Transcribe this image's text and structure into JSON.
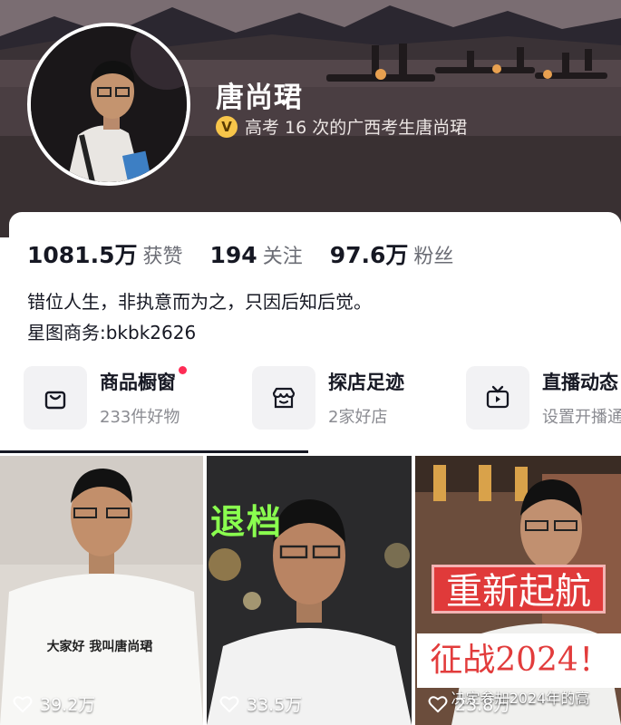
{
  "profile": {
    "nickname": "唐尚珺",
    "verify_text": "高考 16 次的广西考生唐尚珺",
    "verify_badge": "V"
  },
  "stats": [
    {
      "value": "1081.5万",
      "label": "获赞"
    },
    {
      "value": "194",
      "label": "关注"
    },
    {
      "value": "97.6万",
      "label": "粉丝"
    }
  ],
  "bio": {
    "line1": "错位人生，非执意而为之，只因后知后觉。",
    "line2": "星图商务:bkbk2626"
  },
  "features": [
    {
      "title": "商品橱窗",
      "subtitle": "233件好物",
      "icon": "shopping-bag-icon"
    },
    {
      "title": "探店足迹",
      "subtitle": "2家好店",
      "icon": "storefront-icon"
    },
    {
      "title": "直播动态",
      "subtitle": "设置开播通",
      "icon": "tv-icon"
    }
  ],
  "videos": [
    {
      "likes": "39.2万",
      "caption": "大家好 我叫唐尚珺"
    },
    {
      "likes": "33.5万",
      "caption": "退档"
    },
    {
      "likes": "23.8万",
      "caption_top": "重新起航",
      "caption_mid": "征战2024！",
      "caption_sub": "决定参加2024年的高"
    }
  ],
  "colors": {
    "accent": "#fe2c55",
    "verify_badge": "#f7c54a",
    "text_primary": "#161823",
    "text_secondary": "#6b6d75"
  }
}
